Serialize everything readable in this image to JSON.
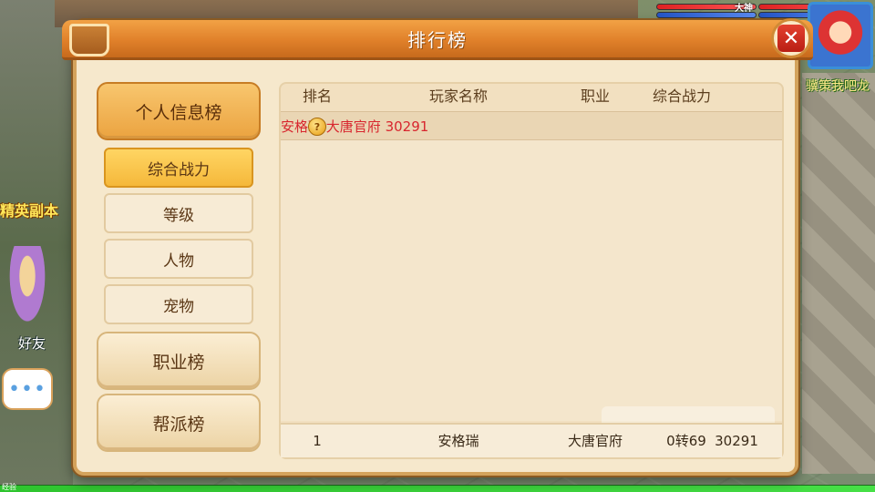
{
  "hud": {
    "top_badge_left": "大神",
    "top_badge_right": "大神",
    "player_name": "骥策我吧龙",
    "left_event_label": "精英副本",
    "friend_label": "好友",
    "chat_dots": "•••",
    "exp_label": "经验"
  },
  "panel": {
    "title": "排行榜",
    "close_label": "✕"
  },
  "sidebar": {
    "categories": [
      {
        "label": "个人信息榜",
        "active": true
      },
      {
        "label": "职业榜",
        "active": false
      },
      {
        "label": "帮派榜",
        "active": false
      }
    ],
    "sub_items": [
      {
        "label": "综合战力",
        "active": true
      },
      {
        "label": "等级",
        "active": false
      },
      {
        "label": "人物",
        "active": false
      },
      {
        "label": "宠物",
        "active": false
      }
    ]
  },
  "table": {
    "headers": [
      "排名",
      "玩家名称",
      "职业",
      "综合战力"
    ],
    "rows": [
      {
        "rank_icon": "gold-medal-icon",
        "rank_text": "?",
        "name": "安格瑞",
        "job": "大唐官府",
        "power": "30291"
      }
    ],
    "my_rank": {
      "rank": "1",
      "name": "安格瑞",
      "job": "大唐官府",
      "level": "0转69",
      "power": "30291"
    }
  }
}
